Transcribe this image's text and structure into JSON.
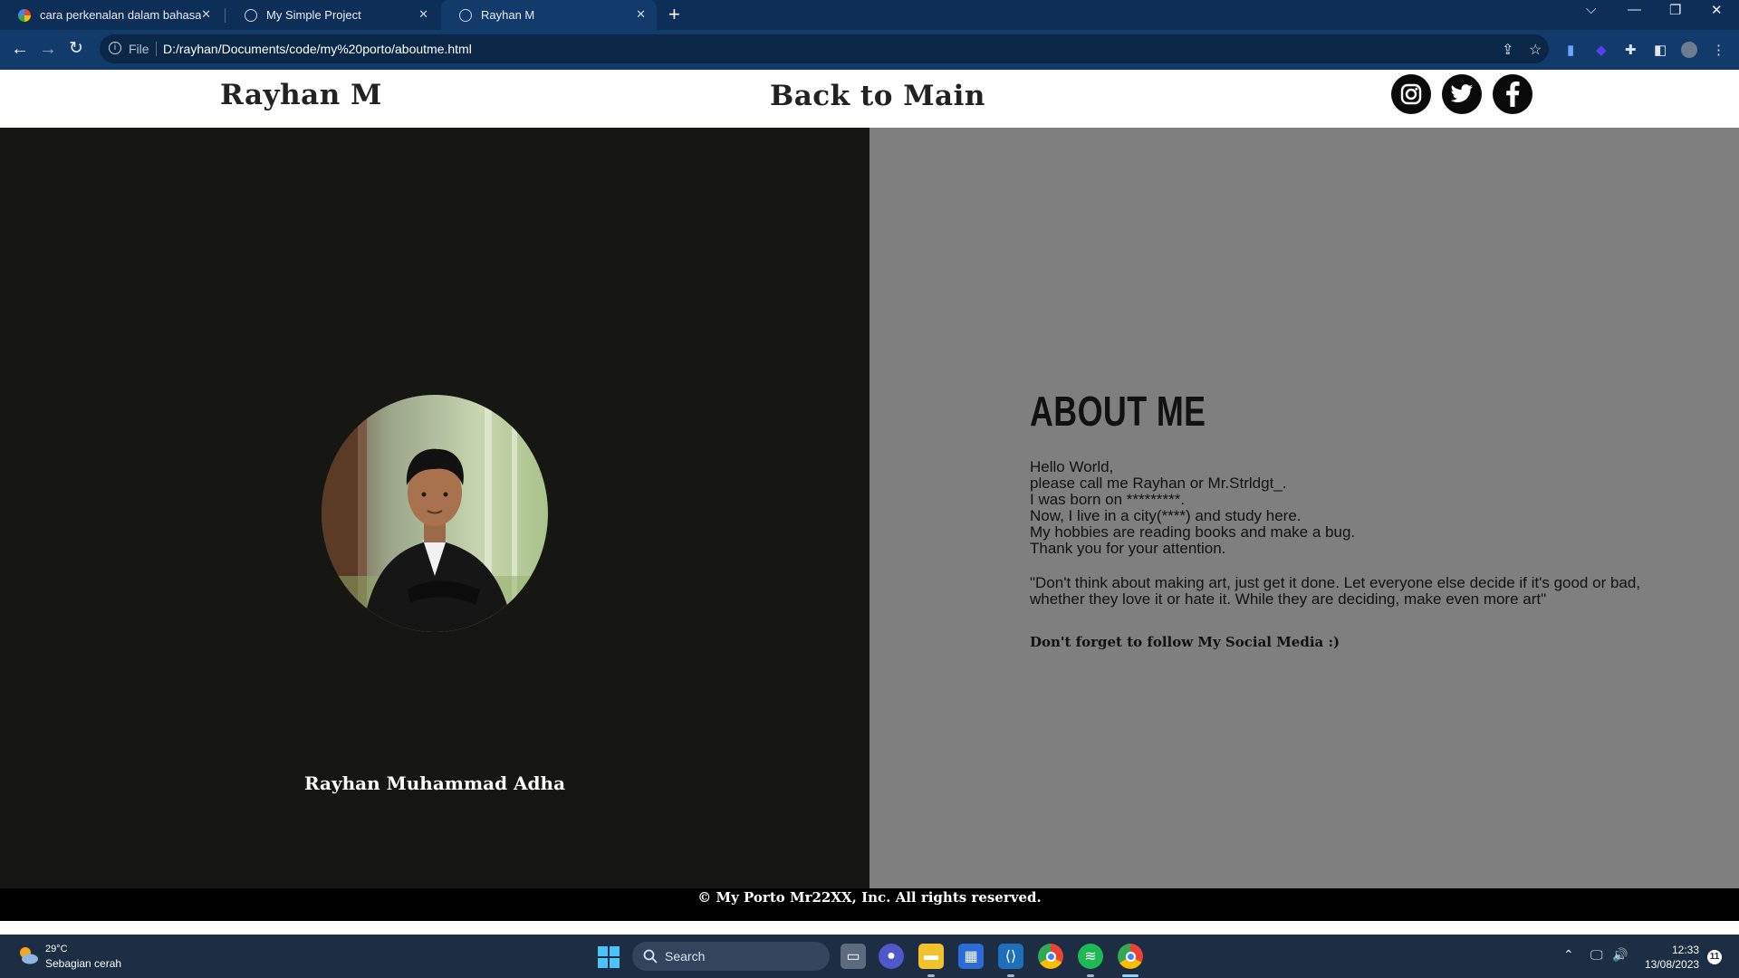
{
  "browser": {
    "tabs": [
      {
        "title": "cara perkenalan dalam bahasa ing",
        "active": false,
        "favicon": "google-icon"
      },
      {
        "title": "My Simple Project",
        "active": false,
        "favicon": "globe-icon"
      },
      {
        "title": "Rayhan M",
        "active": true,
        "favicon": "globe-icon"
      }
    ],
    "omnibox": {
      "scheme_label": "File",
      "url": "D:/rayhan/Documents/code/my%20porto/aboutme.html"
    }
  },
  "header": {
    "brand": "Rayhan M",
    "back_link": "Back to Main",
    "social": [
      "instagram-icon",
      "twitter-icon",
      "facebook-icon"
    ]
  },
  "profile": {
    "full_name": "Rayhan Muhammad Adha"
  },
  "about": {
    "title": "ABOUT ME",
    "lines": [
      "Hello World,",
      "please call me Rayhan or Mr.Strldgt_.",
      "I was born on *********.",
      "Now, I live in a city(****) and study here.",
      "My hobbies are reading books and make a bug.",
      "Thank you for your attention."
    ],
    "quote": "\"Don't think about making art, just get it done. Let everyone else decide if it's good or bad, whether they love it or hate it. While they are deciding, make even more art\"",
    "follow": "Don't forget to follow My Social Media :)"
  },
  "footer": {
    "text": "© My Porto Mr22XX, Inc. All rights reserved."
  },
  "taskbar": {
    "weather_temp": "29°C",
    "weather_desc": "Sebagian cerah",
    "search_placeholder": "Search",
    "time": "12:33",
    "date": "13/08/2023",
    "notification_count": "11"
  },
  "colors": {
    "left_panel": "#161612",
    "right_panel": "#7f7f7f",
    "chrome_tabstrip": "#0d2e56",
    "chrome_toolbar": "#123b6b",
    "taskbar": "#1c2d44"
  }
}
